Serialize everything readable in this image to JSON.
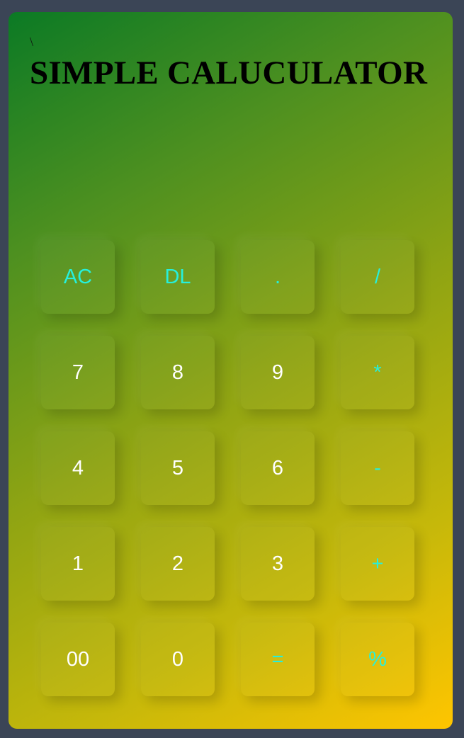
{
  "header": {
    "stray_text": "\\",
    "title": "SIMPLE CALUCULATOR"
  },
  "display": {
    "value": ""
  },
  "colors": {
    "page_background": "#3b4556",
    "gradient_start": "#0b7a25",
    "gradient_end": "#ffc500",
    "digit_text": "#ffffff",
    "operator_text": "#26f0dc",
    "title_text": "#000000"
  },
  "keys": {
    "ac": "AC",
    "dl": "DL",
    "dot": ".",
    "divide": "/",
    "seven": "7",
    "eight": "8",
    "nine": "9",
    "multiply": "*",
    "four": "4",
    "five": "5",
    "six": "6",
    "minus": "-",
    "one": "1",
    "two": "2",
    "three": "3",
    "plus": "+",
    "double_zero": "00",
    "zero": "0",
    "equals": "=",
    "percent": "%"
  }
}
